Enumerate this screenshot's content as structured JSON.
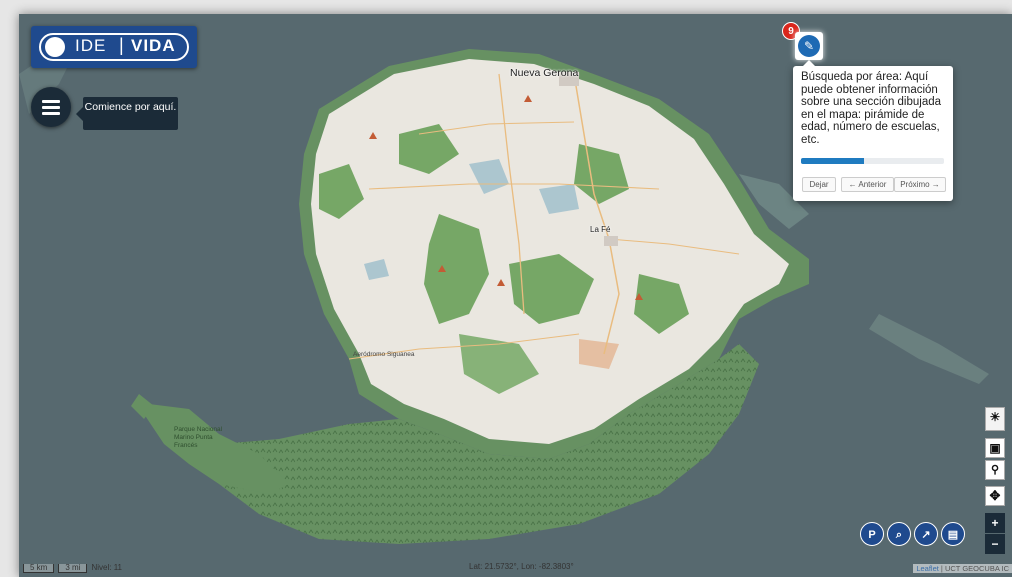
{
  "logo": {
    "text_left": "IDE",
    "text_right": "VIDA"
  },
  "menu": {
    "tip": "Comience por aquí."
  },
  "tour": {
    "badge": "9",
    "text": "Búsqueda por área: Aquí puede obtener información sobre una sección dibujada en el mapa: pirámide de edad, número de escuelas, etc.",
    "progress": 0.44,
    "buttons": {
      "skip": "Dejar",
      "prev": "← Anterior",
      "next": "Próximo →"
    }
  },
  "map": {
    "cities": [
      "Nueva Gerona",
      "La Fé"
    ],
    "places": [
      "Aeródromo Siguanea"
    ],
    "park": "Parque Nacional Marino Punta Francés",
    "zoom_controls": {
      "in": "+",
      "out": "−"
    },
    "colors": {
      "sea": "#4f6168",
      "land": "#e9e6df",
      "forest": "#6fa35e",
      "mangrove": "#5f8c5a",
      "roads": "#e8b979",
      "water": "#a8c3cd"
    }
  },
  "status": {
    "scale_km": "5 km",
    "scale_mi": "3 mi",
    "level": "Nivel: 11",
    "coords": "Lat: 21.5732°, Lon: -82.3803°"
  },
  "attribution": {
    "leaflet": "Leaflet",
    "rest": " | UCT GEOCUBA IC"
  },
  "icons": [
    "ide-vida-logo",
    "menu-icon",
    "edit-icon",
    "weather-icon",
    "layers-icon",
    "pin-icon",
    "move-icon",
    "parking-icon",
    "search-icon",
    "chart-icon",
    "map-icon"
  ]
}
